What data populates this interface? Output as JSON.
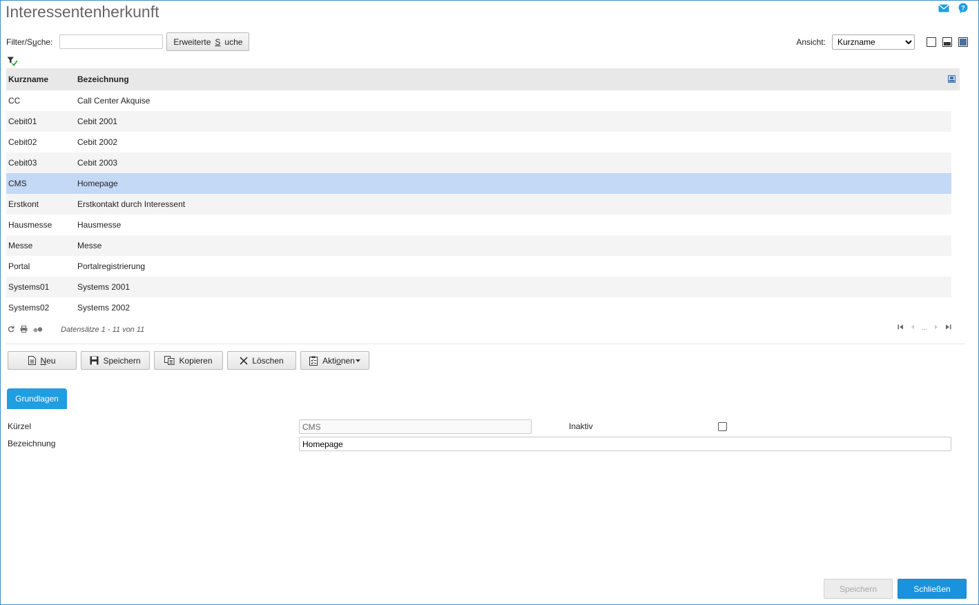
{
  "page": {
    "title": "Interessentenherkunft"
  },
  "header_icons": [
    "mail-icon",
    "help-icon"
  ],
  "filter": {
    "label": "Filter/Suche:",
    "value": "",
    "extended_search_label": "Erweiterte Suche"
  },
  "view": {
    "label": "Ansicht:",
    "selected": "Kurzname",
    "options": [
      "Kurzname"
    ]
  },
  "grid": {
    "columns": [
      "Kurzname",
      "Bezeichnung"
    ],
    "rows": [
      {
        "kurzname": "CC",
        "bezeichnung": "Call Center Akquise"
      },
      {
        "kurzname": "Cebit01",
        "bezeichnung": "Cebit 2001"
      },
      {
        "kurzname": "Cebit02",
        "bezeichnung": "Cebit 2002"
      },
      {
        "kurzname": "Cebit03",
        "bezeichnung": "Cebit 2003"
      },
      {
        "kurzname": "CMS",
        "bezeichnung": "Homepage"
      },
      {
        "kurzname": "Erstkont",
        "bezeichnung": "Erstkontakt durch Interessent"
      },
      {
        "kurzname": "Hausmesse",
        "bezeichnung": "Hausmesse"
      },
      {
        "kurzname": "Messe",
        "bezeichnung": "Messe"
      },
      {
        "kurzname": "Portal",
        "bezeichnung": "Portalregistrierung"
      },
      {
        "kurzname": "Systems01",
        "bezeichnung": "Systems 2001"
      },
      {
        "kurzname": "Systems02",
        "bezeichnung": "Systems 2002"
      }
    ],
    "selected_index": 4
  },
  "pager": {
    "info": "Datensätze 1 - 11 von 11",
    "ellipsis": "..."
  },
  "toolbar": {
    "new_label": "Neu",
    "save_label": "Speichern",
    "copy_label": "Kopieren",
    "delete_label": "Löschen",
    "actions_label": "Aktionen"
  },
  "tabs": {
    "basics_label": "Grundlagen"
  },
  "form": {
    "kuerzel_label": "Kürzel",
    "kuerzel_value": "CMS",
    "bezeichnung_label": "Bezeichnung",
    "bezeichnung_value": "Homepage",
    "inaktiv_label": "Inaktiv",
    "inaktiv_checked": false
  },
  "footer": {
    "save_label": "Speichern",
    "close_label": "Schließen"
  },
  "colors": {
    "accent": "#1f9ee0",
    "selected_row": "#c4d9f5",
    "header_bg": "#e8e8e8"
  }
}
